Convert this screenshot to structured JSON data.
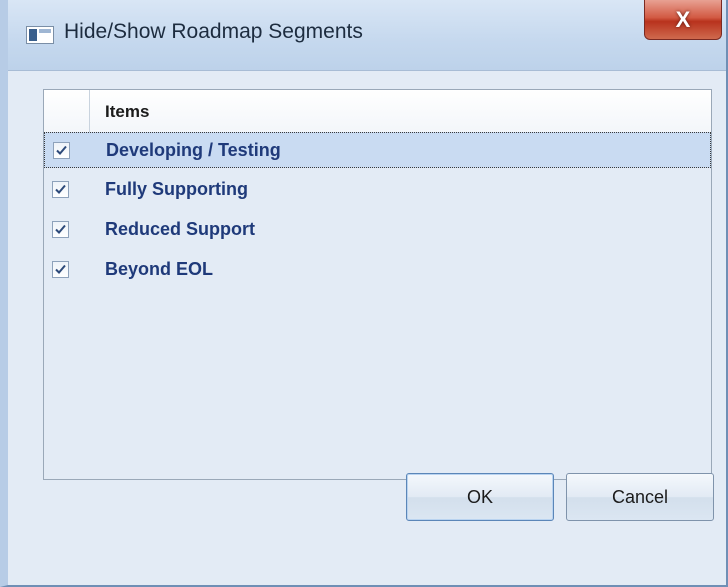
{
  "window": {
    "title": "Hide/Show Roadmap Segments",
    "close_label": "X"
  },
  "list": {
    "header": "Items",
    "items": [
      {
        "label": "Developing / Testing",
        "checked": true,
        "selected": true
      },
      {
        "label": "Fully Supporting",
        "checked": true,
        "selected": false
      },
      {
        "label": "Reduced Support",
        "checked": true,
        "selected": false
      },
      {
        "label": "Beyond EOL",
        "checked": true,
        "selected": false
      }
    ]
  },
  "buttons": {
    "ok_label": "OK",
    "cancel_label": "Cancel"
  },
  "colors": {
    "accent_text": "#1f3a7a",
    "selection": "#c9dbf2",
    "close_button": "#c9432d"
  },
  "icons": {
    "app": "window-app-icon",
    "close": "close-icon",
    "check": "checkmark-icon"
  }
}
